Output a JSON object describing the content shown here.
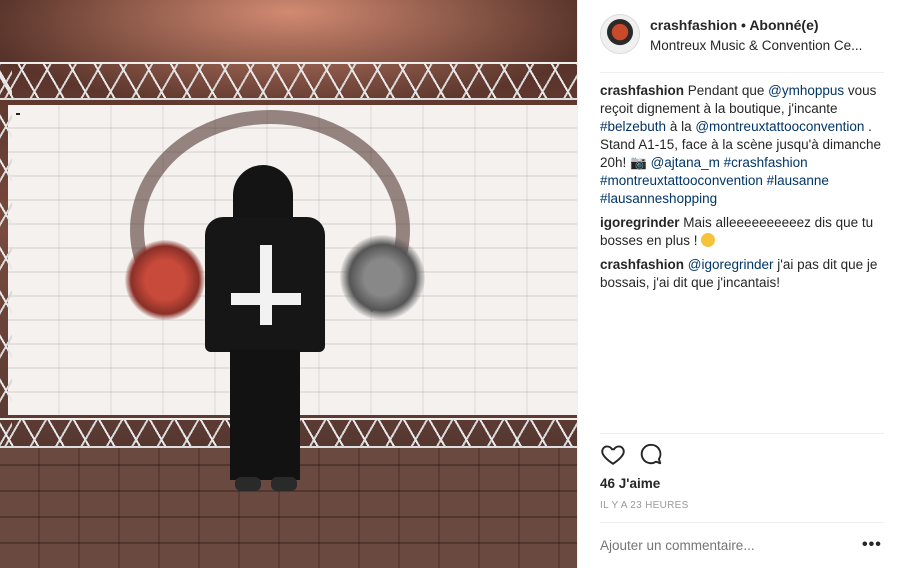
{
  "photo": {
    "alt_icon": "photo-of-person-at-tattoo-convention"
  },
  "header": {
    "username": "crashfashion",
    "separator": "•",
    "follow_status": "Abonné(e)",
    "location": "Montreux Music & Convention Ce..."
  },
  "comments": [
    {
      "username": "crashfashion",
      "parts": [
        {
          "text": "Pendant que ",
          "type": "text"
        },
        {
          "text": "@ymhoppus",
          "type": "tag"
        },
        {
          "text": " vous reçoit dignement à la boutique, j'incante ",
          "type": "text"
        },
        {
          "text": "#belzebuth",
          "type": "tag"
        },
        {
          "text": " à la ",
          "type": "text"
        },
        {
          "text": "@montreuxtattooconvention",
          "type": "tag"
        },
        {
          "text": " . Stand A1-15, face à la scène jusqu'à dimanche 20h! 📷 ",
          "type": "text"
        },
        {
          "text": "@ajtana_m",
          "type": "tag"
        },
        {
          "text": " ",
          "type": "text"
        },
        {
          "text": "#crashfashion",
          "type": "tag"
        },
        {
          "text": " ",
          "type": "text"
        },
        {
          "text": "#montreuxtattooconvention",
          "type": "tag"
        },
        {
          "text": " ",
          "type": "text"
        },
        {
          "text": "#lausanne",
          "type": "tag"
        },
        {
          "text": " ",
          "type": "text"
        },
        {
          "text": "#lausanneshopping",
          "type": "tag"
        }
      ]
    },
    {
      "username": "igoregrinder",
      "parts": [
        {
          "text": "Mais alleeeeeeeeeez dis que tu bosses en plus ! ",
          "type": "text"
        },
        {
          "text": "",
          "type": "emoji"
        }
      ]
    },
    {
      "username": "crashfashion",
      "parts": [
        {
          "text": "@igoregrinder",
          "type": "tag"
        },
        {
          "text": " j'ai pas dit que je bossais, j'ai dit que j'incantais!",
          "type": "text"
        }
      ]
    }
  ],
  "actions": {
    "like_icon": "heart-outline",
    "comment_icon": "speech-bubble"
  },
  "likes_text": "46 J'aime",
  "timestamp": "IL Y A 23 HEURES",
  "add_comment": {
    "placeholder": "Ajouter un commentaire..."
  },
  "more_label": "•••",
  "colors": {
    "tag": "#003569",
    "muted": "#999999",
    "text": "#262626",
    "divider": "#efefef"
  }
}
